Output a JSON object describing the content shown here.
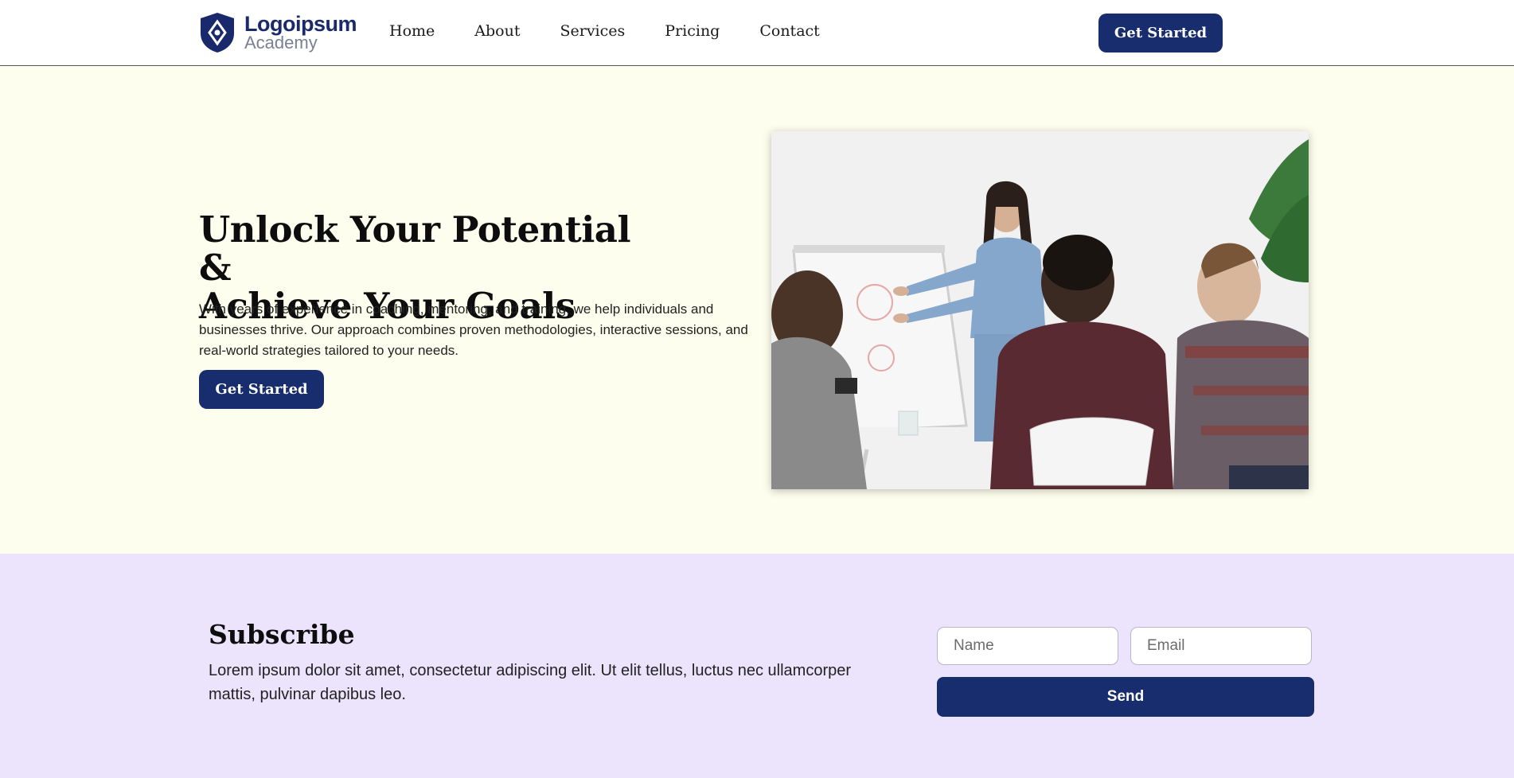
{
  "header": {
    "logo": {
      "name": "Logoipsum",
      "sub": "Academy"
    },
    "nav": [
      "Home",
      "About",
      "Services",
      "Pricing",
      "Contact"
    ],
    "cta_label": "Get Started"
  },
  "hero": {
    "title_line1": "Unlock Your Potential &",
    "title_line2": "Achieve Your Goals",
    "description": "With years of experience in coaching, mentoring, and training, we help individuals and businesses thrive. Our approach combines proven methodologies, interactive sessions, and real-world strategies tailored to your needs.",
    "cta_label": "Get Started"
  },
  "subscribe": {
    "title": "Subscribe",
    "description": "Lorem ipsum dolor sit amet, consectetur adipiscing elit. Ut elit tellus, luctus nec ullamcorper mattis, pulvinar dapibus leo.",
    "name_placeholder": "Name",
    "email_placeholder": "Email",
    "send_label": "Send"
  },
  "colors": {
    "brand": "#182d6e",
    "hero_bg": "#fefeee",
    "subscribe_bg": "#ece3fd"
  }
}
